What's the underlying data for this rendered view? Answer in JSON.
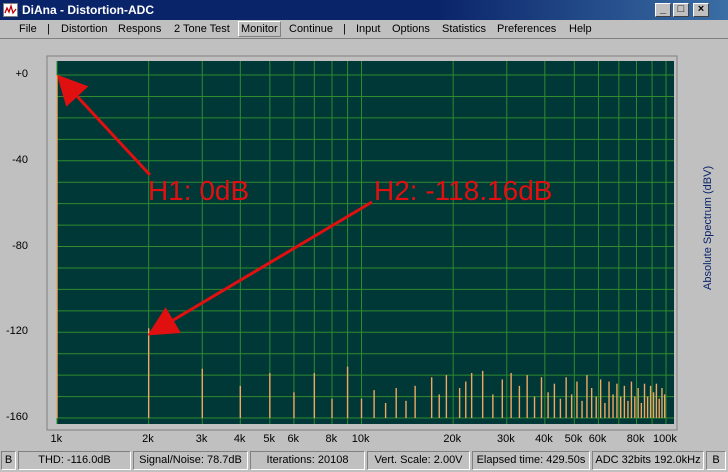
{
  "window": {
    "title": "DiAna - Distortion-ADC",
    "buttons": {
      "minimize": "_",
      "maximize": "□",
      "close": "×"
    }
  },
  "menu": [
    {
      "label": "File",
      "id": "file"
    },
    {
      "label": "|",
      "id": "sep1"
    },
    {
      "label": "Distortion",
      "id": "distortion"
    },
    {
      "label": "Respons",
      "id": "respons"
    },
    {
      "label": "2 Tone Test",
      "id": "two-tone-test"
    },
    {
      "label": "Monitor",
      "id": "monitor"
    },
    {
      "label": "Continue",
      "id": "continue"
    },
    {
      "label": "|",
      "id": "sep2"
    },
    {
      "label": "Input",
      "id": "input"
    },
    {
      "label": "Options",
      "id": "options"
    },
    {
      "label": "Statistics",
      "id": "statistics"
    },
    {
      "label": "Preferences",
      "id": "preferences"
    },
    {
      "label": "Help",
      "id": "help"
    }
  ],
  "chart_data": {
    "type": "bar",
    "ylabel": "Absolute Spectrum (dBV)",
    "ylim": [
      -160,
      0
    ],
    "xscale": "log",
    "xlim": [
      1000,
      100000
    ],
    "y_ticks": [
      {
        "label": "+0",
        "value": 0
      },
      {
        "label": "-40",
        "value": -40
      },
      {
        "label": "-80",
        "value": -80
      },
      {
        "label": "-120",
        "value": -120
      },
      {
        "label": "-160",
        "value": -160
      }
    ],
    "x_ticks": [
      {
        "label": "1k",
        "value": 1000
      },
      {
        "label": "2k",
        "value": 2000
      },
      {
        "label": "3k",
        "value": 3000
      },
      {
        "label": "4k",
        "value": 4000
      },
      {
        "label": "5k",
        "value": 5000
      },
      {
        "label": "6k",
        "value": 6000
      },
      {
        "label": "8k",
        "value": 8000
      },
      {
        "label": "10k",
        "value": 10000
      },
      {
        "label": "20k",
        "value": 20000
      },
      {
        "label": "30k",
        "value": 30000
      },
      {
        "label": "40k",
        "value": 40000
      },
      {
        "label": "50k",
        "value": 50000
      },
      {
        "label": "60k",
        "value": 60000
      },
      {
        "label": "80k",
        "value": 80000
      },
      {
        "label": "100k",
        "value": 100000
      }
    ],
    "harmonics": [
      {
        "x": 1000,
        "y": 0
      },
      {
        "x": 2000,
        "y": -118.16
      },
      {
        "x": 3000,
        "y": -137
      },
      {
        "x": 4000,
        "y": -145
      },
      {
        "x": 5000,
        "y": -139
      },
      {
        "x": 6000,
        "y": -148
      },
      {
        "x": 7000,
        "y": -139
      },
      {
        "x": 8000,
        "y": -151
      },
      {
        "x": 9000,
        "y": -136
      },
      {
        "x": 10000,
        "y": -151
      },
      {
        "x": 11000,
        "y": -147
      },
      {
        "x": 12000,
        "y": -153
      },
      {
        "x": 13000,
        "y": -146
      },
      {
        "x": 14000,
        "y": -152
      },
      {
        "x": 15000,
        "y": -145
      },
      {
        "x": 17000,
        "y": -141
      },
      {
        "x": 18000,
        "y": -149
      },
      {
        "x": 19000,
        "y": -140
      },
      {
        "x": 21000,
        "y": -146
      },
      {
        "x": 22000,
        "y": -143
      },
      {
        "x": 23000,
        "y": -139
      },
      {
        "x": 25000,
        "y": -138
      },
      {
        "x": 27000,
        "y": -149
      },
      {
        "x": 29000,
        "y": -142
      },
      {
        "x": 31000,
        "y": -139
      },
      {
        "x": 33000,
        "y": -145
      },
      {
        "x": 35000,
        "y": -140
      },
      {
        "x": 37000,
        "y": -150
      },
      {
        "x": 39000,
        "y": -141
      },
      {
        "x": 41000,
        "y": -148
      },
      {
        "x": 43000,
        "y": -144
      },
      {
        "x": 45000,
        "y": -151
      },
      {
        "x": 47000,
        "y": -141
      },
      {
        "x": 49000,
        "y": -149
      },
      {
        "x": 51000,
        "y": -143
      },
      {
        "x": 53000,
        "y": -152
      },
      {
        "x": 55000,
        "y": -140
      },
      {
        "x": 57000,
        "y": -146
      },
      {
        "x": 59000,
        "y": -150
      },
      {
        "x": 61000,
        "y": -142
      },
      {
        "x": 63000,
        "y": -153
      },
      {
        "x": 65000,
        "y": -143
      },
      {
        "x": 67000,
        "y": -149
      },
      {
        "x": 69000,
        "y": -144
      },
      {
        "x": 71000,
        "y": -150
      },
      {
        "x": 73000,
        "y": -145
      },
      {
        "x": 75000,
        "y": -152
      },
      {
        "x": 77000,
        "y": -143
      },
      {
        "x": 79000,
        "y": -150
      },
      {
        "x": 81000,
        "y": -146
      },
      {
        "x": 83000,
        "y": -153
      },
      {
        "x": 85000,
        "y": -144
      },
      {
        "x": 87000,
        "y": -150
      },
      {
        "x": 89000,
        "y": -145
      },
      {
        "x": 91000,
        "y": -148
      },
      {
        "x": 93000,
        "y": -144
      },
      {
        "x": 95000,
        "y": -151
      },
      {
        "x": 97000,
        "y": -146
      },
      {
        "x": 99000,
        "y": -149
      }
    ],
    "annotations": [
      {
        "text": "H1: 0dB",
        "target_x": 1000,
        "target_y": 0
      },
      {
        "text": "H2: -118.16dB",
        "target_x": 2000,
        "target_y": -118.16
      }
    ]
  },
  "status": [
    {
      "id": "b-left",
      "label": "B"
    },
    {
      "id": "thd",
      "label": "THD: -116.0dB"
    },
    {
      "id": "snr",
      "label": "Signal/Noise:     78.7dB"
    },
    {
      "id": "iterations",
      "label": "Iterations: 20108"
    },
    {
      "id": "vscale",
      "label": "Vert. Scale: 2.00V"
    },
    {
      "id": "elapsed",
      "label": "Elapsed time: 429.50s"
    },
    {
      "id": "adc",
      "label": "ADC 32bits 192.0kHz"
    },
    {
      "id": "b-right",
      "label": "B"
    }
  ],
  "colors": {
    "plot_bg": "#003838",
    "grid": "#2e8b2e",
    "bars": "#f0a860",
    "annotation": "#e01010",
    "title_bar": "#0a246a"
  }
}
